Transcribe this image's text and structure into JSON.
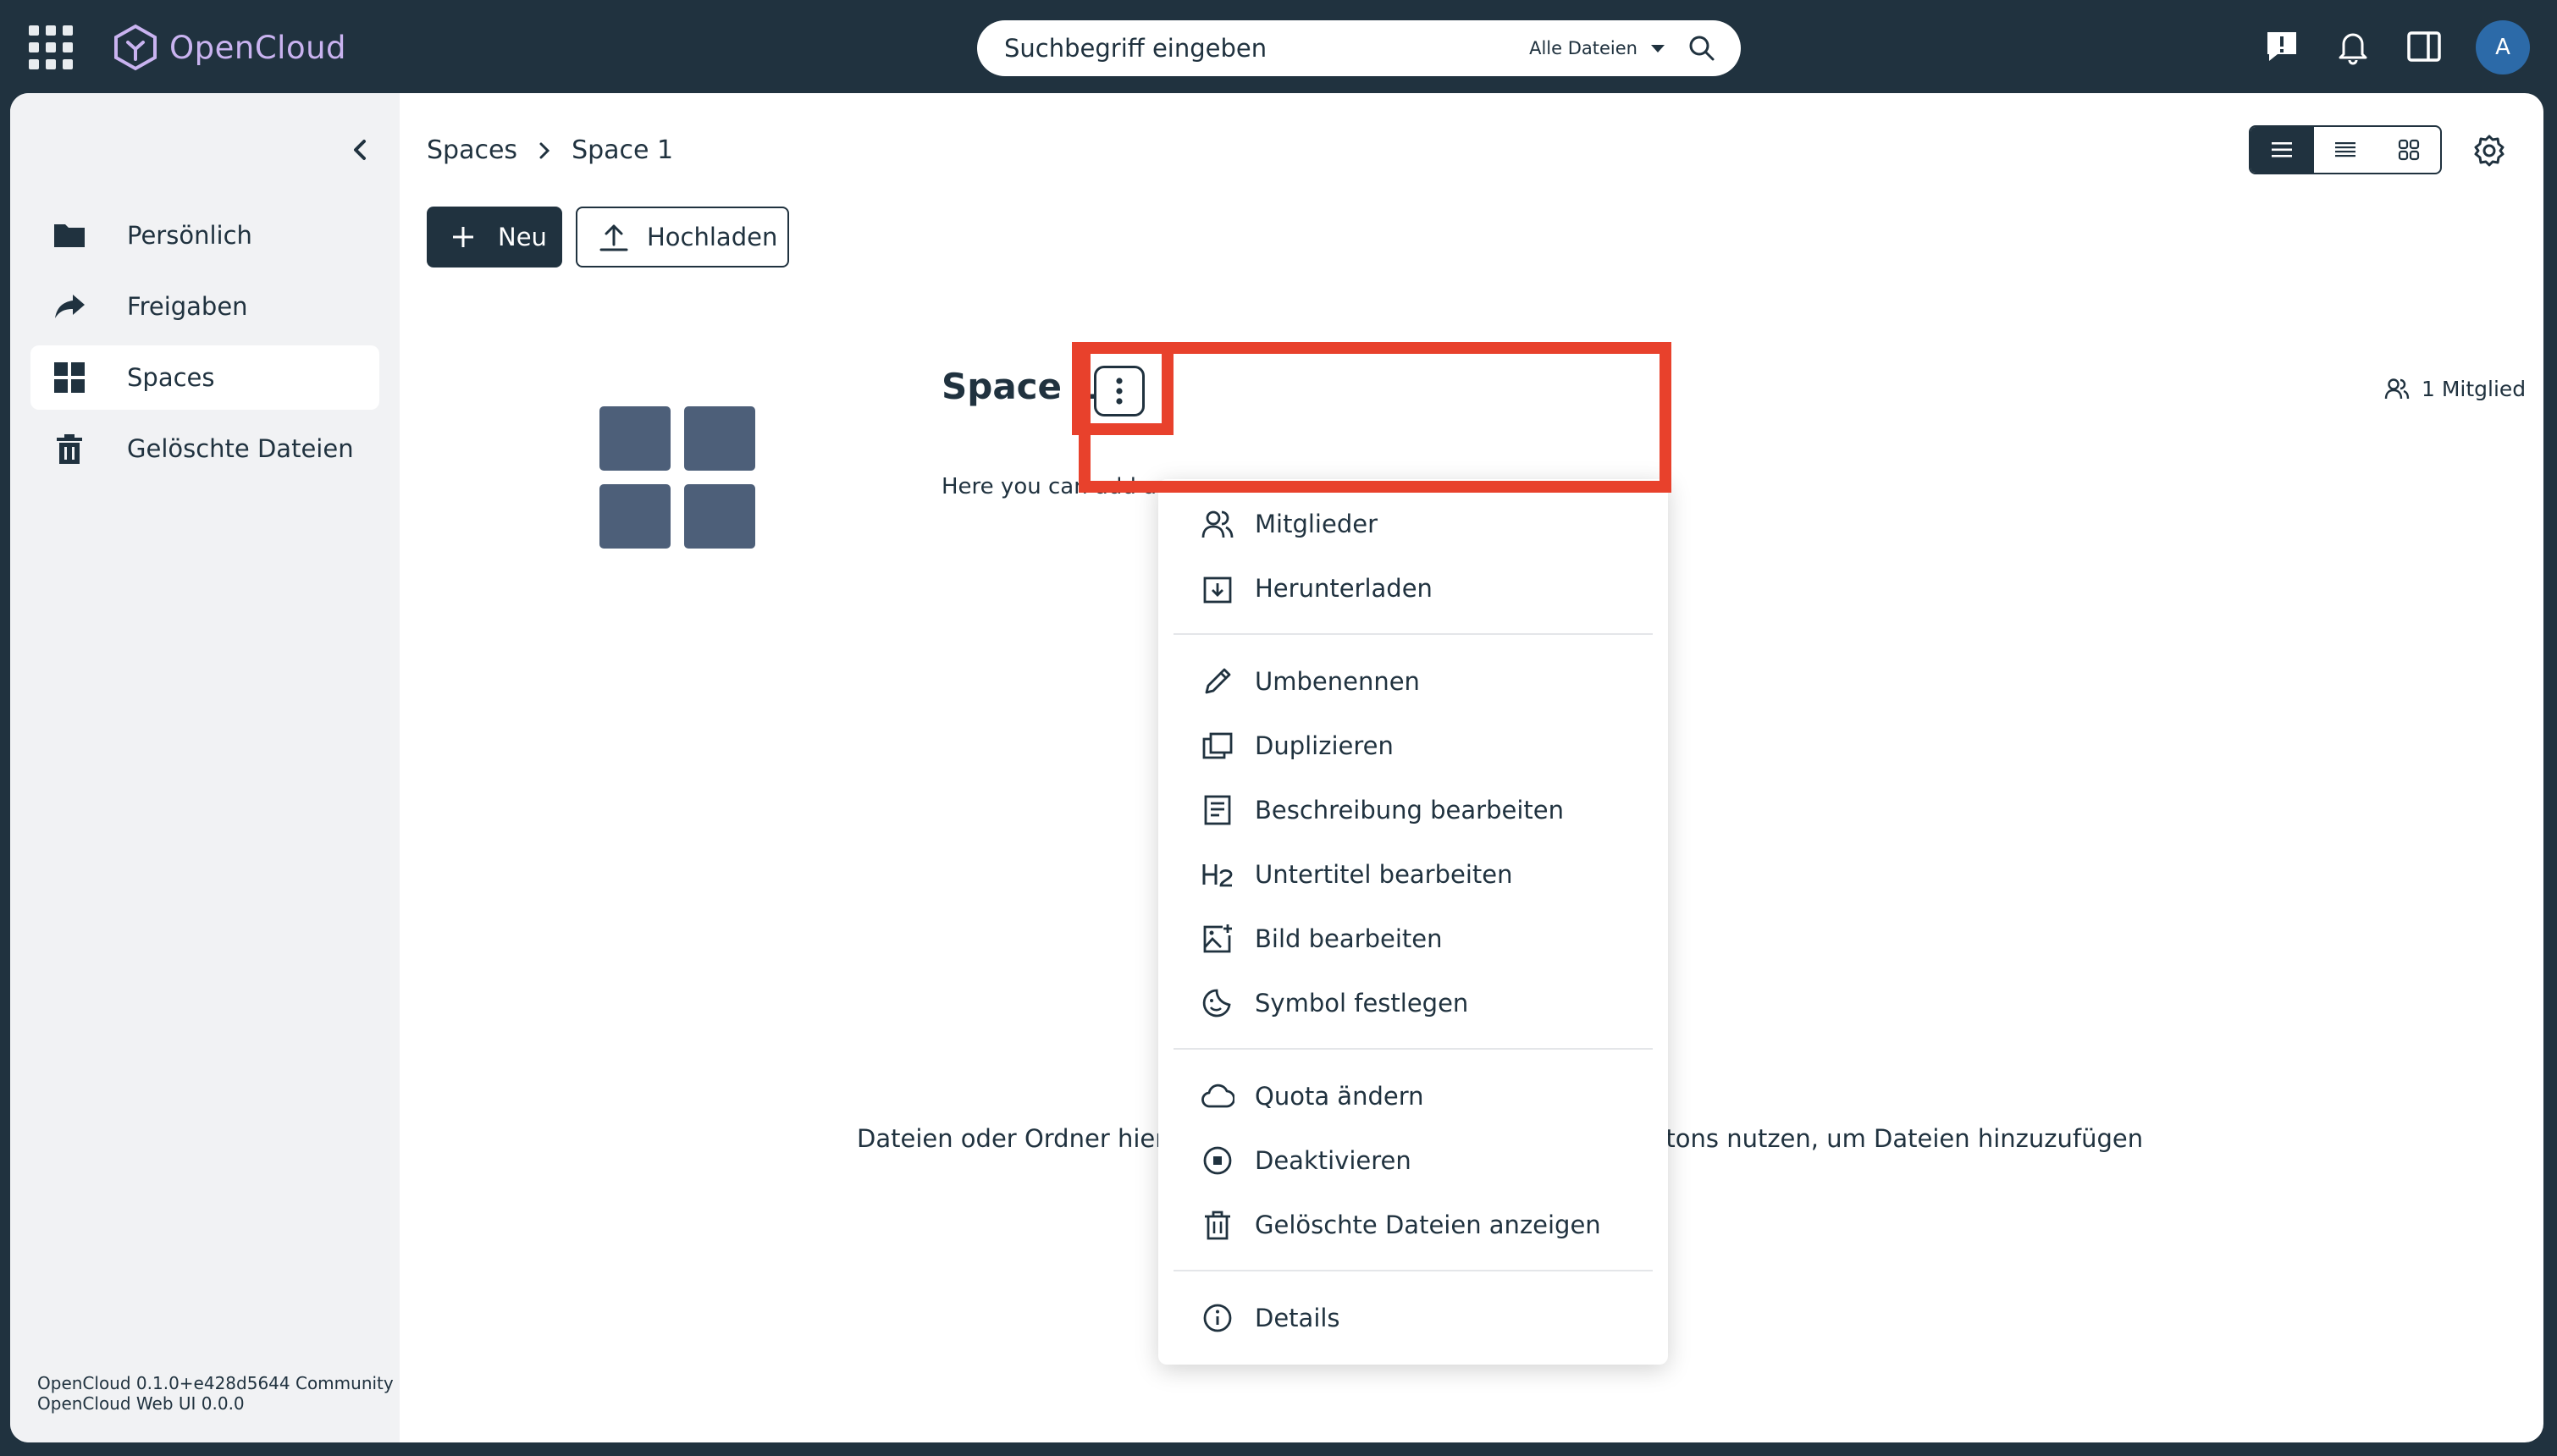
{
  "app": {
    "name": "OpenCloud"
  },
  "search": {
    "placeholder": "Suchbegriff eingeben",
    "scope": "Alle Dateien"
  },
  "user": {
    "avatar_initial": "A"
  },
  "sidebar": {
    "items": [
      {
        "label": "Persönlich",
        "icon": "folder-icon",
        "active": false
      },
      {
        "label": "Freigaben",
        "icon": "share-arrow-icon",
        "active": false
      },
      {
        "label": "Spaces",
        "icon": "spaces-grid-icon",
        "active": true
      },
      {
        "label": "Gelöschte Dateien",
        "icon": "trash-icon",
        "active": false
      }
    ],
    "version_line1": "OpenCloud 0.1.0+e428d5644 Community",
    "version_line2": "OpenCloud Web UI 0.0.0"
  },
  "breadcrumb": {
    "root": "Spaces",
    "current": "Space 1"
  },
  "toolbar": {
    "new_label": "Neu",
    "upload_label": "Hochladen"
  },
  "space": {
    "title": "Space 1",
    "description": "Here you can add a",
    "members": "1 Mitglied"
  },
  "empty_hint": {
    "left": "Dateien oder Ordner hierhe",
    "right": "ttons nutzen, um Dateien hinzuzufügen"
  },
  "context_menu": {
    "members": "Mitglieder",
    "download": "Herunterladen",
    "rename": "Umbenennen",
    "duplicate": "Duplizieren",
    "edit_description": "Beschreibung bearbeiten",
    "edit_subtitle": "Untertitel bearbeiten",
    "edit_image": "Bild bearbeiten",
    "set_icon": "Symbol festlegen",
    "change_quota": "Quota ändern",
    "deactivate": "Deaktivieren",
    "show_trash": "Gelöschte Dateien anzeigen",
    "details": "Details"
  },
  "colors": {
    "topbar": "#20323f",
    "accent_logo": "#c9b3f0",
    "highlight": "#e8412c",
    "avatar": "#2c6aa8"
  }
}
